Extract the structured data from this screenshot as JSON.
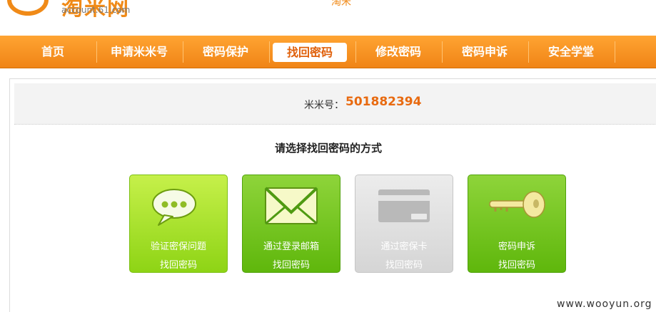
{
  "header": {
    "logo_title": "淘米网",
    "logo_domain": "account.61.com",
    "deco_text": "淘米"
  },
  "nav": {
    "items": [
      {
        "label": "首页"
      },
      {
        "label": "申请米米号"
      },
      {
        "label": "密码保护"
      },
      {
        "label": "找回密码",
        "active": true
      },
      {
        "label": "修改密码"
      },
      {
        "label": "密码申诉"
      },
      {
        "label": "安全学堂"
      }
    ]
  },
  "account": {
    "label": "米米号：",
    "number": "501882394"
  },
  "heading": "请选择找回密码的方式",
  "options": [
    {
      "line1": "验证密保问题",
      "line2": "找回密码",
      "icon": "chat-bubble-icon",
      "enabled": true
    },
    {
      "line1": "通过登录邮箱",
      "line2": "找回密码",
      "icon": "envelope-icon",
      "enabled": true
    },
    {
      "line1": "通过密保卡",
      "line2": "找回密码",
      "icon": "card-icon",
      "enabled": false
    },
    {
      "line1": "密码申诉",
      "line2": "找回密码",
      "icon": "key-icon",
      "enabled": true
    }
  ],
  "colors": {
    "brand_orange": "#f08a18",
    "account_number": "#e86a10",
    "option_green": "#7cc417",
    "option_disabled": "#d9d9d9"
  },
  "watermark": "www.wooyun.org"
}
